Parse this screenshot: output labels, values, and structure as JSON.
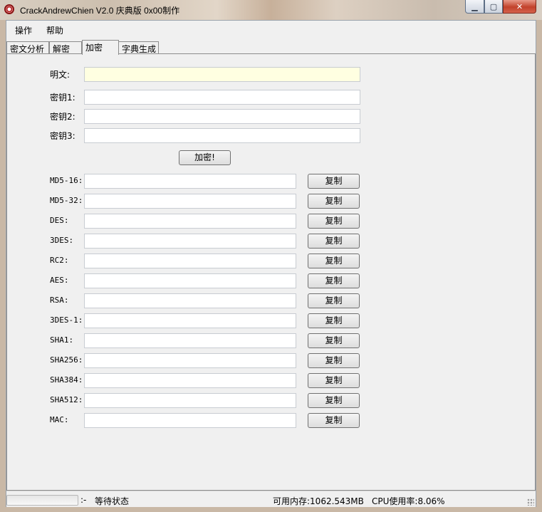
{
  "window": {
    "title": "CrackAndrewChien V2.0 庆典版  0x00制作",
    "icon": "app-icon",
    "controls": {
      "minimize": "▁",
      "maximize": "▢",
      "close": "✕"
    }
  },
  "menu": {
    "items": [
      {
        "label": "操作"
      },
      {
        "label": "帮助"
      }
    ]
  },
  "tabs": [
    {
      "label": "密文分析",
      "active": false
    },
    {
      "label": "解密",
      "active": false
    },
    {
      "label": "加密",
      "active": true
    },
    {
      "label": "字典生成",
      "active": false
    }
  ],
  "encrypt": {
    "plaintext": {
      "label": "明文:",
      "value": ""
    },
    "keys": [
      {
        "label": "密钥1:",
        "value": ""
      },
      {
        "label": "密钥2:",
        "value": ""
      },
      {
        "label": "密钥3:",
        "value": ""
      }
    ],
    "encrypt_button": "加密!",
    "copy_label": "复制",
    "outputs": [
      {
        "label": "MD5-16:",
        "value": ""
      },
      {
        "label": "MD5-32:",
        "value": ""
      },
      {
        "label": "DES:",
        "value": ""
      },
      {
        "label": "3DES:",
        "value": ""
      },
      {
        "label": "RC2:",
        "value": ""
      },
      {
        "label": "AES:",
        "value": ""
      },
      {
        "label": "RSA:",
        "value": ""
      },
      {
        "label": "3DES-1:",
        "value": ""
      },
      {
        "label": "SHA1:",
        "value": ""
      },
      {
        "label": "SHA256:",
        "value": ""
      },
      {
        "label": "SHA384:",
        "value": ""
      },
      {
        "label": "SHA512:",
        "value": ""
      },
      {
        "label": "MAC:",
        "value": ""
      }
    ]
  },
  "status": {
    "separator": ":-",
    "state": "等待状态",
    "memory": "可用内存:1062.543MB",
    "cpu": "CPU使用率:8.06%"
  },
  "colors": {
    "plaintext_bg": "#ffffe1",
    "window_bg": "#f0f0f0",
    "close_button": "#c2422b"
  }
}
